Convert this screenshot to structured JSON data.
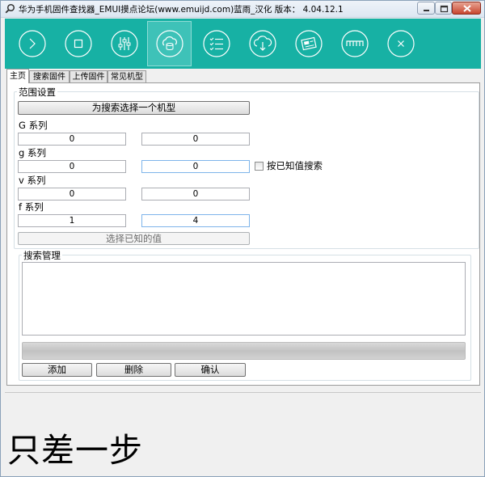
{
  "window": {
    "title": "华为手机固件查找器_EMUI摸点论坛(www.emuijd.com)蓝雨_汉化 版本： 4.04.12.1"
  },
  "colors": {
    "toolbar": "#17b1a4",
    "toolbar_active": "#3ec2b8",
    "icon_stroke": "#ffffff"
  },
  "toolbar": {
    "icons": [
      "next-circle-icon",
      "stop-square-icon",
      "equalizer-icon",
      "cloud-database-icon",
      "checklist-icon",
      "cloud-download-icon",
      "firmware-image-icon",
      "connector-icon",
      "close-circle-icon"
    ],
    "active_index": 3
  },
  "tabs": [
    {
      "label": "主页",
      "selected": true
    },
    {
      "label": "搜索固件",
      "selected": false
    },
    {
      "label": "上传固件",
      "selected": false
    },
    {
      "label": "常见机型",
      "selected": false
    }
  ],
  "scope": {
    "title": "范围设置",
    "select_model_button": "为搜索选择一个机型",
    "series": [
      {
        "label": "G 系列",
        "from": "0",
        "to": "0"
      },
      {
        "label": "g 系列",
        "from": "0",
        "to": "0"
      },
      {
        "label": "v 系列",
        "from": "0",
        "to": "0"
      },
      {
        "label": "f 系列",
        "from": "1",
        "to": "4"
      }
    ],
    "known_value_search_label": "按已知值搜索",
    "known_value_search_checked": false,
    "select_known_button": "选择已知的值"
  },
  "search_manage": {
    "title": "搜索管理",
    "log_text": "",
    "add_button": "添加",
    "delete_button": "删除",
    "confirm_button": "确认"
  },
  "overlay_caption": "只差一步"
}
